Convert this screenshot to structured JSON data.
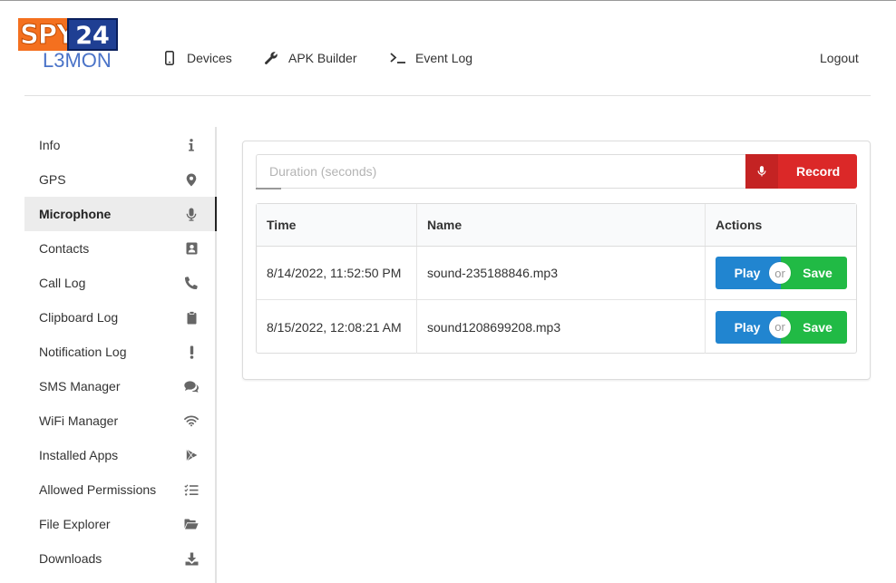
{
  "logo": {
    "badge_left": "SPY",
    "badge_right": "24",
    "product": "L3MON"
  },
  "nav": [
    {
      "label": "Devices",
      "icon": "mobile-phone-icon"
    },
    {
      "label": "APK Builder",
      "icon": "wrench-icon"
    },
    {
      "label": "Event Log",
      "icon": "terminal-icon"
    }
  ],
  "logout_label": "Logout",
  "sidebar": {
    "active": "Microphone",
    "items": [
      {
        "label": "Info",
        "icon": "info-icon"
      },
      {
        "label": "GPS",
        "icon": "map-marker-icon"
      },
      {
        "label": "Microphone",
        "icon": "microphone-icon"
      },
      {
        "label": "Contacts",
        "icon": "address-book-icon"
      },
      {
        "label": "Call Log",
        "icon": "phone-icon"
      },
      {
        "label": "Clipboard Log",
        "icon": "clipboard-icon"
      },
      {
        "label": "Notification Log",
        "icon": "exclamation-icon"
      },
      {
        "label": "SMS Manager",
        "icon": "comments-icon"
      },
      {
        "label": "WiFi Manager",
        "icon": "wifi-icon"
      },
      {
        "label": "Installed Apps",
        "icon": "play-store-icon"
      },
      {
        "label": "Allowed Permissions",
        "icon": "tasks-list-icon"
      },
      {
        "label": "File Explorer",
        "icon": "folder-open-icon"
      },
      {
        "label": "Downloads",
        "icon": "download-icon"
      }
    ]
  },
  "recorder": {
    "duration_placeholder": "Duration (seconds)",
    "duration_value": "",
    "record_label": "Record"
  },
  "table": {
    "headers": {
      "time": "Time",
      "name": "Name",
      "actions": "Actions"
    },
    "rows": [
      {
        "time": "8/14/2022, 11:52:50 PM",
        "name": "sound-235188846.mp3"
      },
      {
        "time": "8/15/2022, 12:08:21 AM",
        "name": "sound1208699208.mp3"
      }
    ],
    "play_label": "Play",
    "or_label": "or",
    "save_label": "Save"
  },
  "colors": {
    "record": "#db2828",
    "play": "#2185d0",
    "save": "#21ba45",
    "logo_orange": "#f4701f",
    "logo_blue": "#1f3f93",
    "logo_text": "#4a73c8"
  }
}
